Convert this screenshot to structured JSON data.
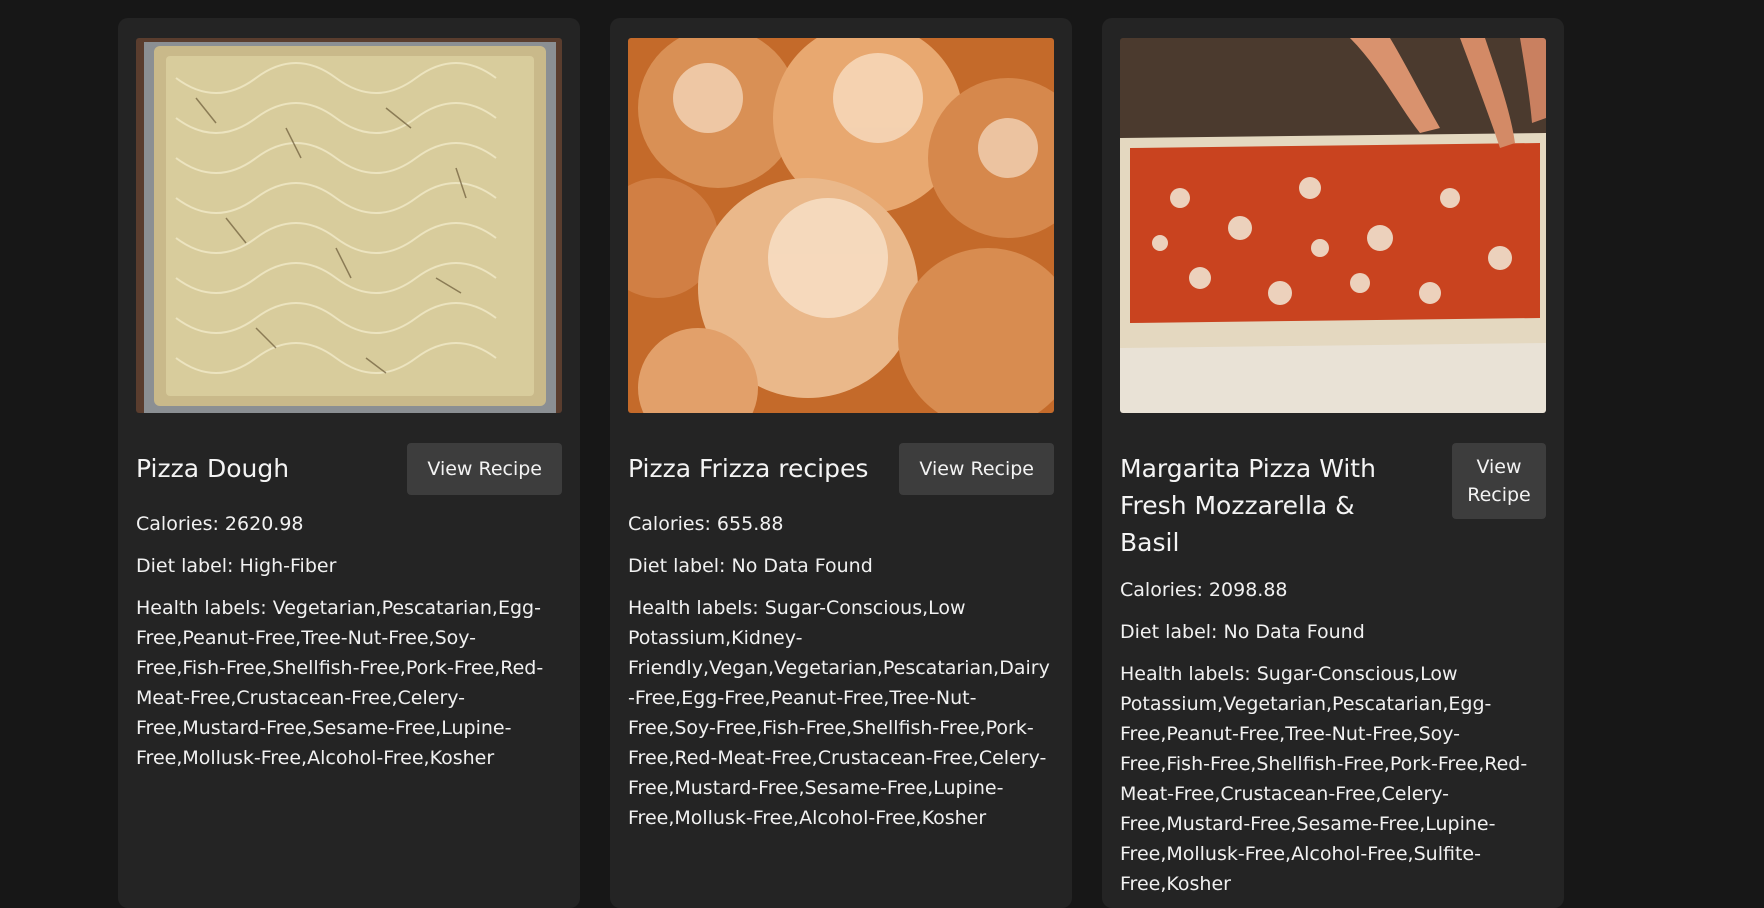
{
  "recipes": [
    {
      "title": "Pizza Dough",
      "button": "View Recipe",
      "calories": "Calories: 2620.98",
      "diet": "Diet label: High-Fiber",
      "health": "Health labels: Vegetarian,Pescatarian,Egg-Free,Peanut-Free,Tree-Nut-Free,Soy-Free,Fish-Free,Shellfish-Free,Pork-Free,Red-Meat-Free,Crustacean-Free,Celery-Free,Mustard-Free,Sesame-Free,Lupine-Free,Mollusk-Free,Alcohol-Free,Kosher"
    },
    {
      "title": "Pizza Frizza recipes",
      "button": "View Recipe",
      "calories": "Calories: 655.88",
      "diet": "Diet label: No Data Found",
      "health": "Health labels: Sugar-Conscious,Low Potassium,Kidney-Friendly,Vegan,Vegetarian,Pescatarian,Dairy-Free,Egg-Free,Peanut-Free,Tree-Nut-Free,Soy-Free,Fish-Free,Shellfish-Free,Pork-Free,Red-Meat-Free,Crustacean-Free,Celery-Free,Mustard-Free,Sesame-Free,Lupine-Free,Mollusk-Free,Alcohol-Free,Kosher"
    },
    {
      "title": "Margarita Pizza With Fresh Mozzarella & Basil",
      "button": "View Recipe",
      "calories": "Calories: 2098.88",
      "diet": "Diet label: No Data Found",
      "health": "Health labels: Sugar-Conscious,Low Potassium,Vegetarian,Pescatarian,Egg-Free,Peanut-Free,Tree-Nut-Free,Soy-Free,Fish-Free,Shellfish-Free,Pork-Free,Red-Meat-Free,Crustacean-Free,Celery-Free,Mustard-Free,Sesame-Free,Lupine-Free,Mollusk-Free,Alcohol-Free,Sulfite-Free,Kosher"
    }
  ]
}
